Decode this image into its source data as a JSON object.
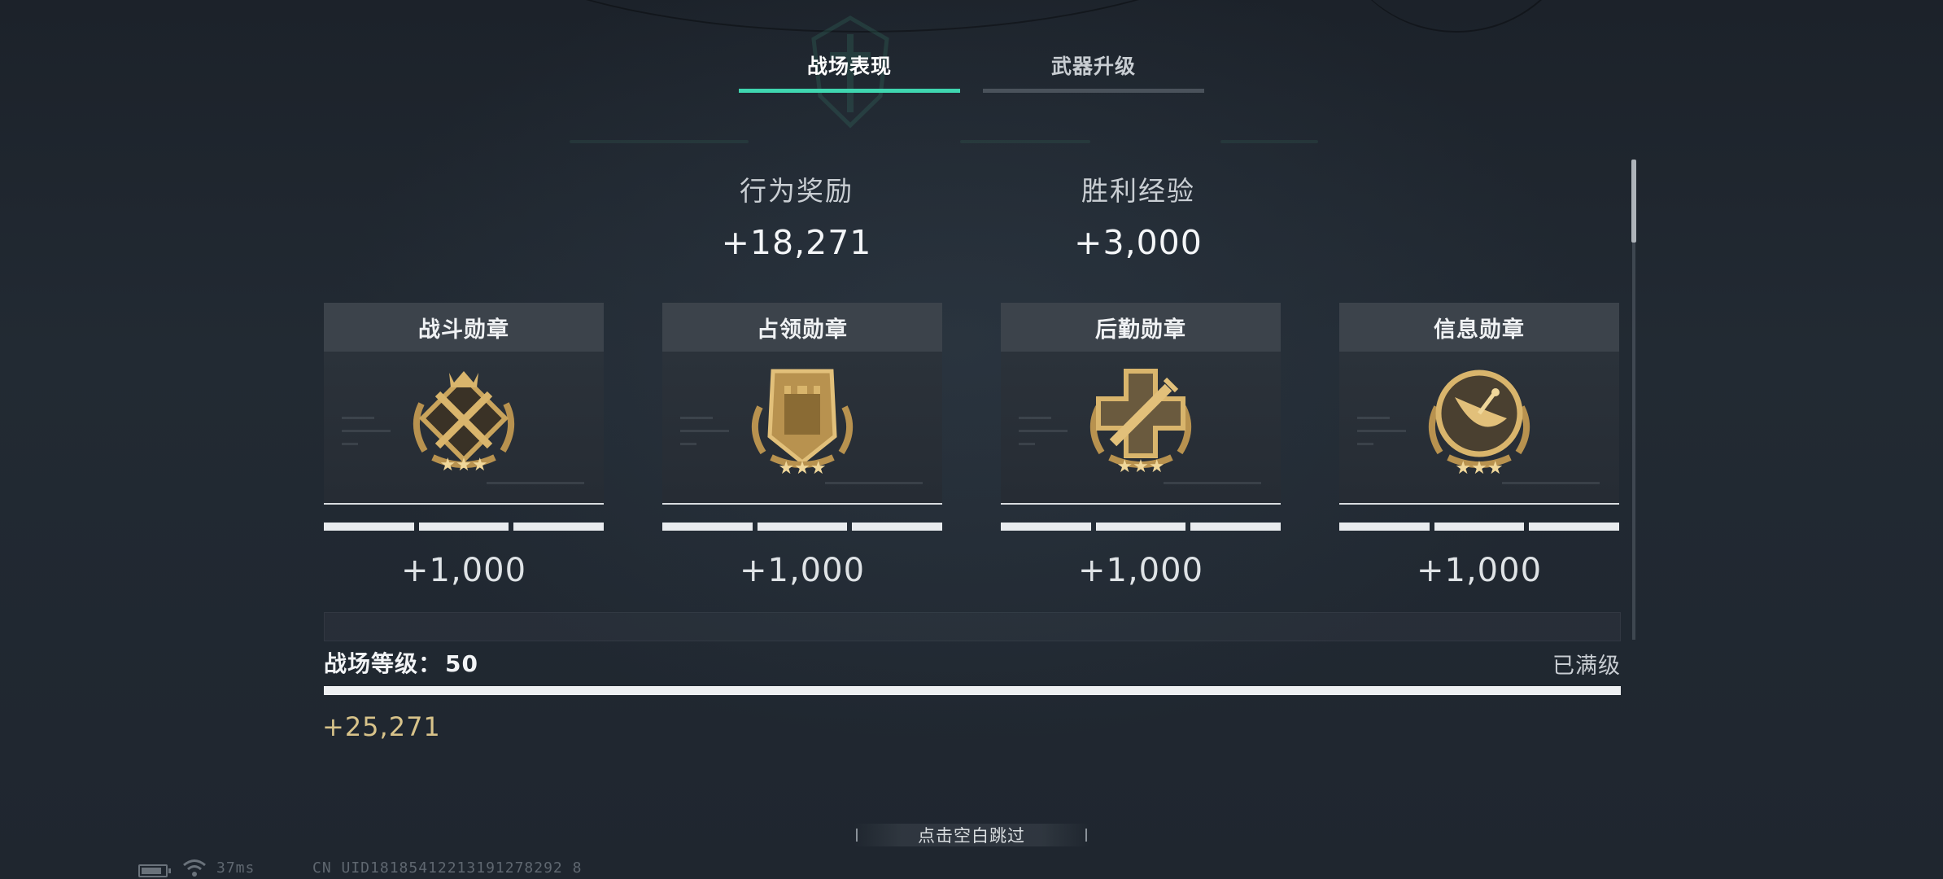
{
  "tabs": [
    {
      "label": "战场表现",
      "active": true
    },
    {
      "label": "武器升级",
      "active": false
    }
  ],
  "summary": [
    {
      "label": "行为奖励",
      "value": "+18,271"
    },
    {
      "label": "胜利经验",
      "value": "+3,000"
    }
  ],
  "medals": [
    {
      "name": "战斗勋章",
      "icon": "combat-medal-icon",
      "value": "+1,000",
      "progress_segments": 3
    },
    {
      "name": "占领勋章",
      "icon": "capture-medal-icon",
      "value": "+1,000",
      "progress_segments": 3
    },
    {
      "name": "后勤勋章",
      "icon": "logistics-medal-icon",
      "value": "+1,000",
      "progress_segments": 3
    },
    {
      "name": "信息勋章",
      "icon": "intel-medal-icon",
      "value": "+1,000",
      "progress_segments": 3
    }
  ],
  "level": {
    "label": "战场等级：",
    "value": "50",
    "status": "已满级",
    "progress_fraction": 1.0,
    "total_gain": "+25,271"
  },
  "skip_label": "点击空白跳过",
  "status_bar": {
    "latency": "37ms",
    "uid": "CN UID18185412213191278292 8"
  },
  "colors": {
    "accent": "#3fd6b0",
    "gold": "#d8c38a",
    "medal_gold": "#c9a45c"
  }
}
